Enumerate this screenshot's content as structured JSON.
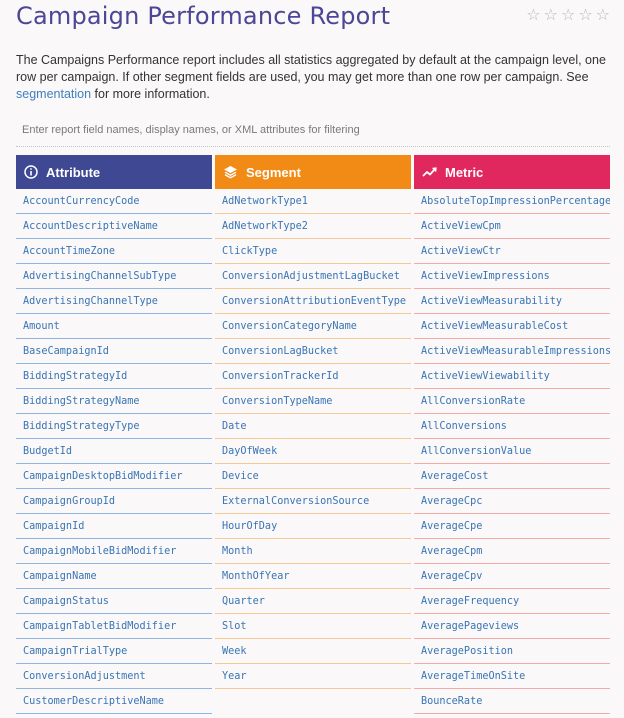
{
  "header": {
    "title": "Campaign Performance Report",
    "stars": [
      "☆",
      "☆",
      "☆",
      "☆",
      "☆"
    ]
  },
  "description": {
    "text_before": "The Campaigns Performance report includes all statistics aggregated by default at the campaign level, one row per campaign. If other segment fields are used, you may get more than one row per campaign. See ",
    "link_text": "segmentation",
    "text_after": " for more information."
  },
  "filter": {
    "placeholder": "Enter report field names, display names, or XML attributes for filtering",
    "value": ""
  },
  "columns": {
    "attribute": {
      "header": "Attribute",
      "icon": "info-circle-icon",
      "color": "#3f4993",
      "items": [
        "AccountCurrencyCode",
        "AccountDescriptiveName",
        "AccountTimeZone",
        "AdvertisingChannelSubType",
        "AdvertisingChannelType",
        "Amount",
        "BaseCampaignId",
        "BiddingStrategyId",
        "BiddingStrategyName",
        "BiddingStrategyType",
        "BudgetId",
        "CampaignDesktopBidModifier",
        "CampaignGroupId",
        "CampaignId",
        "CampaignMobileBidModifier",
        "CampaignName",
        "CampaignStatus",
        "CampaignTabletBidModifier",
        "CampaignTrialType",
        "ConversionAdjustment",
        "CustomerDescriptiveName"
      ]
    },
    "segment": {
      "header": "Segment",
      "icon": "layers-icon",
      "color": "#f28a16",
      "items": [
        "AdNetworkType1",
        "AdNetworkType2",
        "ClickType",
        "ConversionAdjustmentLagBucket",
        "ConversionAttributionEventType",
        "ConversionCategoryName",
        "ConversionLagBucket",
        "ConversionTrackerId",
        "ConversionTypeName",
        "Date",
        "DayOfWeek",
        "Device",
        "ExternalConversionSource",
        "HourOfDay",
        "Month",
        "MonthOfYear",
        "Quarter",
        "Slot",
        "Week",
        "Year"
      ]
    },
    "metric": {
      "header": "Metric",
      "icon": "trend-line-icon",
      "color": "#e0285e",
      "items": [
        "AbsoluteTopImpressionPercentage",
        "ActiveViewCpm",
        "ActiveViewCtr",
        "ActiveViewImpressions",
        "ActiveViewMeasurability",
        "ActiveViewMeasurableCost",
        "ActiveViewMeasurableImpressions",
        "ActiveViewViewability",
        "AllConversionRate",
        "AllConversions",
        "AllConversionValue",
        "AverageCost",
        "AverageCpc",
        "AverageCpe",
        "AverageCpm",
        "AverageCpv",
        "AverageFrequency",
        "AveragePageviews",
        "AveragePosition",
        "AverageTimeOnSite",
        "BounceRate"
      ]
    }
  }
}
